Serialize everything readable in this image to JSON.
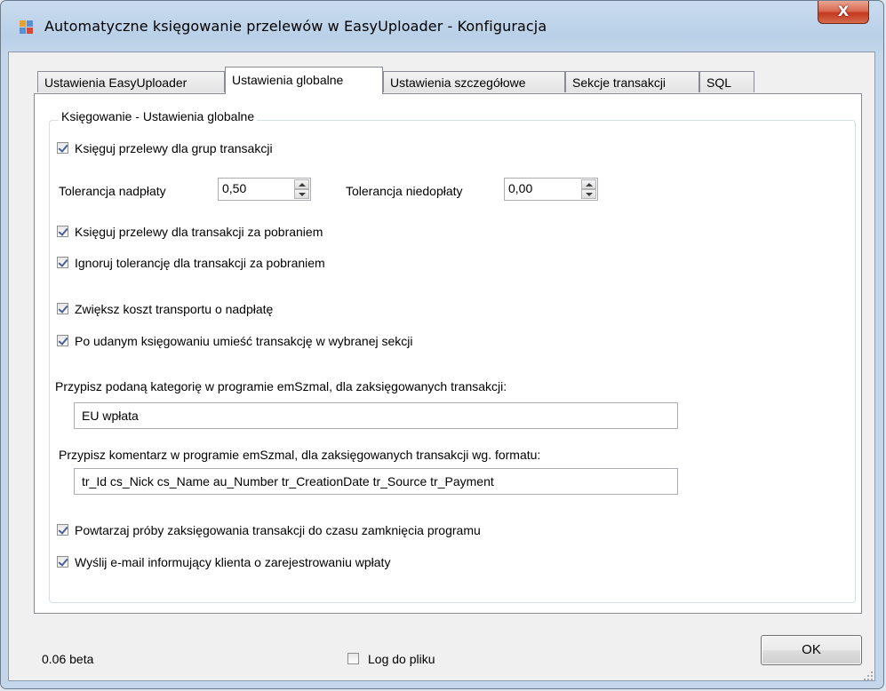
{
  "window": {
    "title": "Automatyczne księgowanie przelewów w EasyUploader - Konfiguracja",
    "close_label": "X"
  },
  "tabs": [
    {
      "label": "Ustawienia EasyUploader",
      "active": false
    },
    {
      "label": "Ustawienia globalne",
      "active": true
    },
    {
      "label": "Ustawienia szczegółowe",
      "active": false
    },
    {
      "label": "Sekcje transakcji",
      "active": false
    },
    {
      "label": "SQL",
      "active": false
    }
  ],
  "group": {
    "legend": "Księgowanie - Ustawienia globalne"
  },
  "options": {
    "post_groups": {
      "label": "Księguj przelewy dla grup transakcji",
      "checked": true
    },
    "post_cod": {
      "label": "Księguj przelewy dla transakcji za pobraniem",
      "checked": true
    },
    "ignore_tolerance_cod": {
      "label": "Ignoruj tolerancję dla transakcji za pobraniem",
      "checked": true
    },
    "increase_shipping": {
      "label": "Zwiększ koszt transportu o nadpłatę",
      "checked": true
    },
    "move_to_section": {
      "label": "Po udanym księgowaniu umieść transakcję w wybranej sekcji",
      "checked": true
    },
    "retry_until_close": {
      "label": "Powtarzaj próby zaksięgowania transakcji do czasu zamknięcia programu",
      "checked": true
    },
    "send_email": {
      "label": "Wyślij e-mail informujący klienta o zarejestrowaniu wpłaty",
      "checked": true
    }
  },
  "tolerance": {
    "overpay_label": "Tolerancja nadpłaty",
    "overpay_value": "0,50",
    "underpay_label": "Tolerancja niedopłaty",
    "underpay_value": "0,00"
  },
  "category": {
    "label": "Przypisz podaną kategorię w programie emSzmal, dla zaksięgowanych transakcji:",
    "value": "EU wpłata"
  },
  "comment": {
    "label": "Przypisz komentarz w programie emSzmal, dla zaksięgowanych transakcji wg. formatu:",
    "value": "tr_Id cs_Nick cs_Name au_Number tr_CreationDate tr_Source tr_Payment"
  },
  "footer": {
    "version": "0.06 beta",
    "log_label": "Log do pliku",
    "log_checked": false,
    "ok_label": "OK"
  },
  "colors": {
    "titlebar": "#b9d0e8",
    "close_button": "#c4391f",
    "checkmark": "#4a5f97"
  }
}
